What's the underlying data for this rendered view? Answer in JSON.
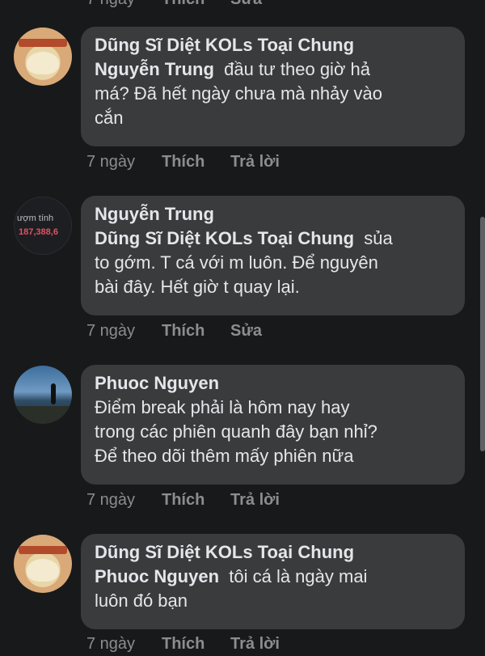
{
  "top_actions": {
    "time": "7 ngày",
    "like": "Thích",
    "edit": "Sửa"
  },
  "comments": [
    {
      "author": "Dũng Sĩ Diệt KOLs Toại Chung",
      "mention": "Nguyễn Trung",
      "text_first": "đầu tư theo giờ hả",
      "text_rest": [
        "má? Đã hết ngày chưa mà nhảy vào",
        "cắn"
      ],
      "time": "7 ngày",
      "like": "Thích",
      "action": "Trả lời"
    },
    {
      "author": "Nguyễn Trung",
      "avatar_label": "ượm tính",
      "avatar_value": "187,388,6",
      "mention": "Dũng Sĩ Diệt KOLs Toại Chung",
      "text_first": "sủa",
      "text_rest": [
        "to gớm. T cá với m luôn. Để nguyên",
        "bài đây. Hết giờ t quay lại."
      ],
      "time": "7 ngày",
      "like": "Thích",
      "action": "Sửa"
    },
    {
      "author": "Phuoc Nguyen",
      "text_lines": [
        "Điểm break phải là hôm nay hay",
        "trong các phiên quanh đây bạn nhỉ?",
        "Để theo dõi thêm mấy phiên nữa"
      ],
      "time": "7 ngày",
      "like": "Thích",
      "action": "Trả lời"
    },
    {
      "author": "Dũng Sĩ Diệt KOLs Toại Chung",
      "mention": "Phuoc Nguyen",
      "text_first": "tôi cá là ngày mai",
      "text_rest": [
        "luôn đó bạn"
      ],
      "time": "7 ngày",
      "like": "Thích",
      "action": "Trả lời"
    }
  ],
  "colors": {
    "background": "#18191a",
    "bubble": "#3a3b3c",
    "meta": "#8a8d91",
    "text": "#e4e6eb"
  }
}
